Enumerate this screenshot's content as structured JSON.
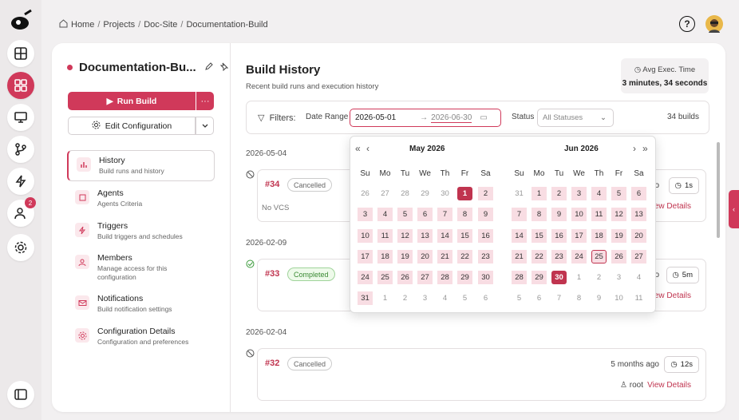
{
  "colors": {
    "accent": "#d0395a"
  },
  "rail": {
    "icons": [
      "logo-icon",
      "layout-icon",
      "dashboard-icon",
      "monitor-icon",
      "git-branch-icon",
      "lightning-icon",
      "users-icon",
      "settings-icon",
      "sidebar-toggle-icon"
    ],
    "badge": "2"
  },
  "breadcrumb": [
    "Home",
    "Projects",
    "Doc-Site",
    "Documentation-Build"
  ],
  "breadcrumb_sep": "/",
  "project": {
    "title": "Documentation-Bu...",
    "run_label": "Run Build",
    "more_label": "···",
    "config_label": "Edit Configuration"
  },
  "nav": [
    {
      "title": "History",
      "sub": "Build runs and history"
    },
    {
      "title": "Agents",
      "sub": "Agents Criteria"
    },
    {
      "title": "Triggers",
      "sub": "Build triggers and schedules"
    },
    {
      "title": "Members",
      "sub": "Manage access for this configuration"
    },
    {
      "title": "Notifications",
      "sub": "Build notification settings"
    },
    {
      "title": "Configuration Details",
      "sub": "Configuration and preferences"
    }
  ],
  "main": {
    "title": "Build History",
    "subtitle": "Recent build runs and execution history",
    "avg_label": "Avg Exec. Time",
    "avg_value": "3 minutes, 34 seconds",
    "filters_label": "Filters:",
    "date_range_label": "Date Range",
    "date_start": "2026-05-01",
    "date_arrow": "→",
    "date_end": "2026-06-30",
    "status_label": "Status",
    "status_placeholder": "All Statuses",
    "count": "34 builds"
  },
  "groups": [
    {
      "date": "2026-05-04",
      "num": "#34",
      "status": "Cancelled",
      "duration": "1s",
      "trail": "o"
    },
    {
      "date": "2026-02-09",
      "num": "#33",
      "status": "Completed",
      "duration": "5m",
      "trail": "o"
    },
    {
      "date": "2026-02-04",
      "num": "#32",
      "status": "Cancelled",
      "duration": "12s",
      "ago": "5 months ago",
      "user": "root"
    }
  ],
  "run34_vcs": "No VCS",
  "view_details": "View Details",
  "calendar": {
    "nav": {
      "prev_year": "«",
      "prev_month": "‹",
      "next_month": "›",
      "next_year": "»"
    },
    "weekdays": [
      "Su",
      "Mo",
      "Tu",
      "We",
      "Th",
      "Fr",
      "Sa"
    ],
    "months": [
      {
        "name": "May 2026",
        "days": [
          [
            "26",
            "27",
            "28",
            "29",
            "30",
            "1",
            "2"
          ],
          [
            "3",
            "4",
            "5",
            "6",
            "7",
            "8",
            "9"
          ],
          [
            "10",
            "11",
            "12",
            "13",
            "14",
            "15",
            "16"
          ],
          [
            "17",
            "18",
            "19",
            "20",
            "21",
            "22",
            "23"
          ],
          [
            "24",
            "25",
            "26",
            "27",
            "28",
            "29",
            "30"
          ],
          [
            "31",
            "1",
            "2",
            "3",
            "4",
            "5",
            "6"
          ]
        ]
      },
      {
        "name": "Jun 2026",
        "days": [
          [
            "31",
            "1",
            "2",
            "3",
            "4",
            "5",
            "6"
          ],
          [
            "7",
            "8",
            "9",
            "10",
            "11",
            "12",
            "13"
          ],
          [
            "14",
            "15",
            "16",
            "17",
            "18",
            "19",
            "20"
          ],
          [
            "21",
            "22",
            "23",
            "24",
            "25",
            "26",
            "27"
          ],
          [
            "28",
            "29",
            "30",
            "1",
            "2",
            "3",
            "4"
          ],
          [
            "5",
            "6",
            "7",
            "8",
            "9",
            "10",
            "11"
          ]
        ]
      }
    ]
  },
  "edge_handle": "‹"
}
